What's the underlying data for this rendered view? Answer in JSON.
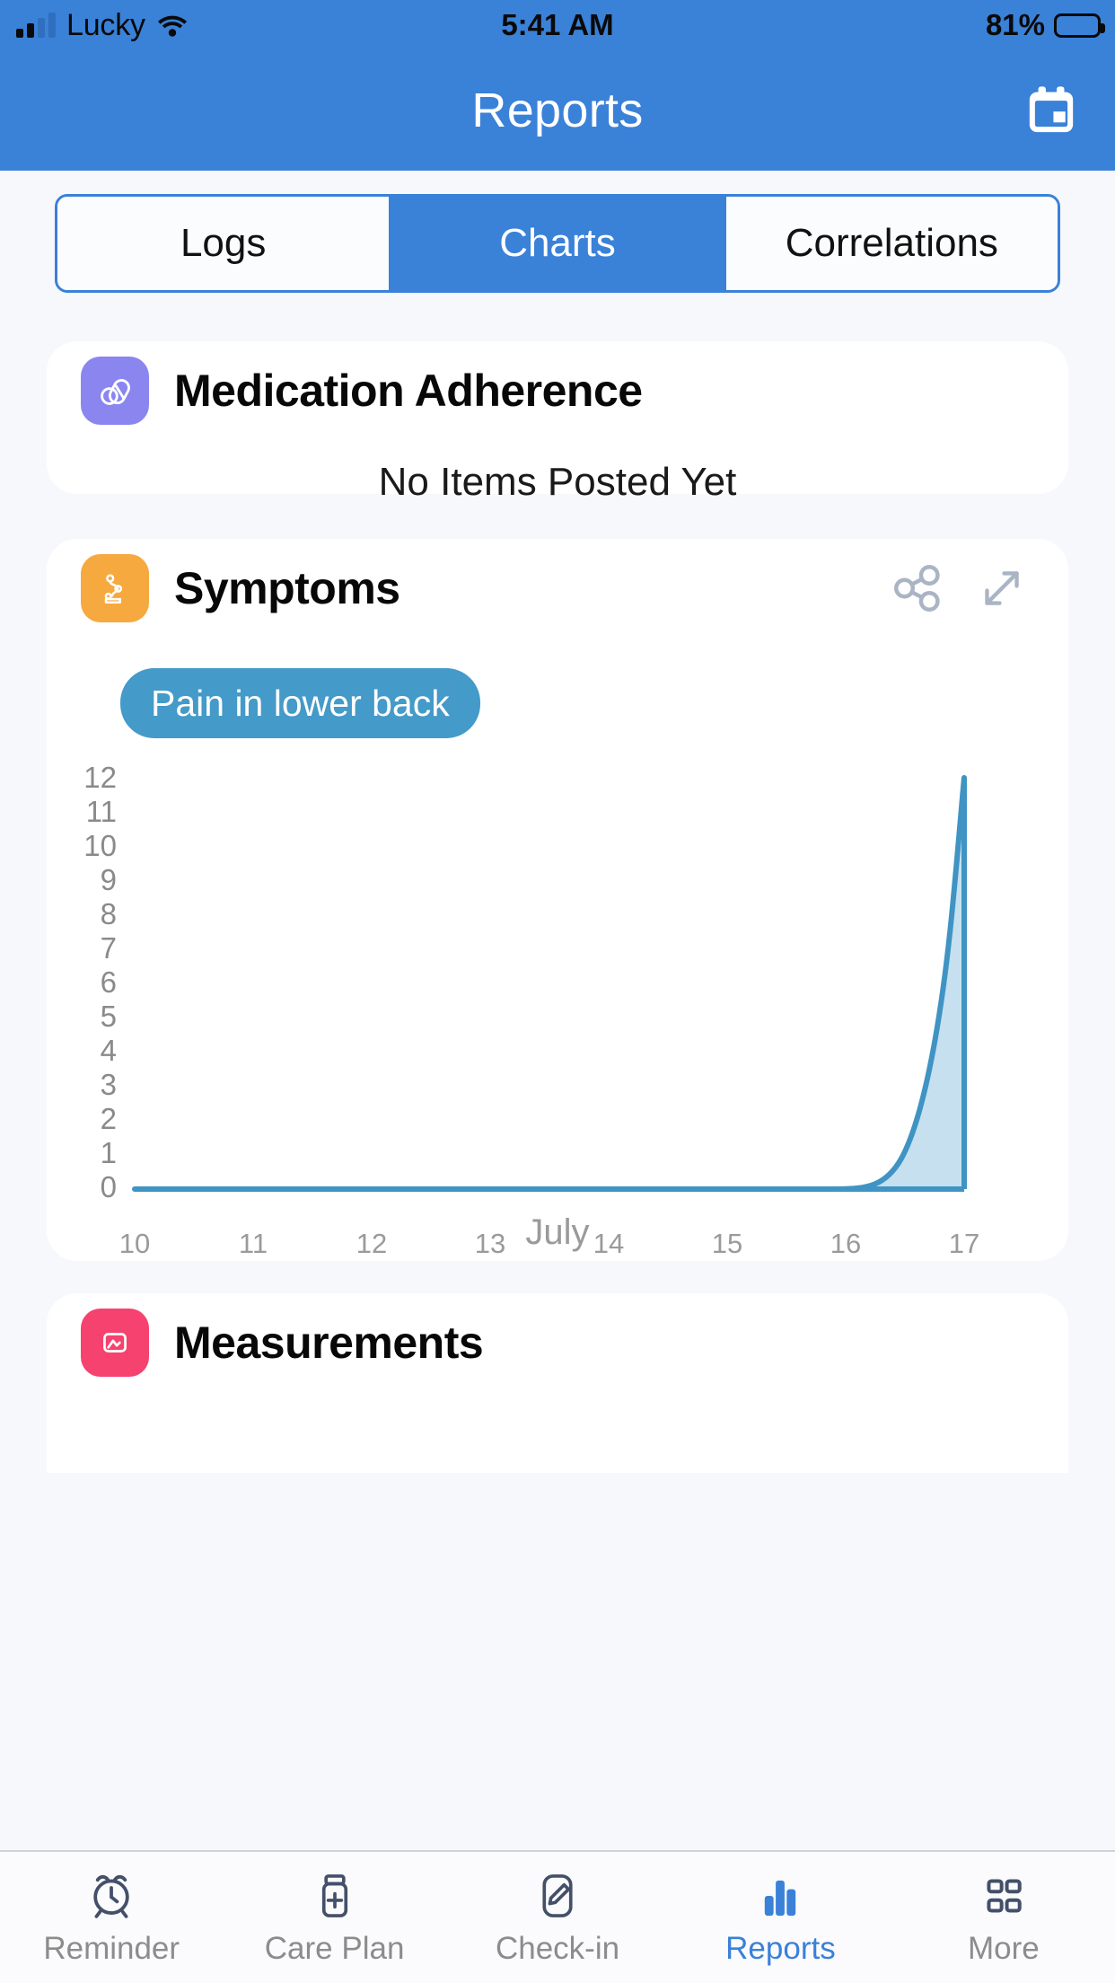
{
  "status_bar": {
    "carrier": "Lucky",
    "time": "5:41 AM",
    "battery_percent": "81%",
    "signal_icon": "cellular-signal-icon",
    "wifi_icon": "wifi-icon",
    "battery_icon": "battery-icon"
  },
  "nav": {
    "title": "Reports",
    "action_icon": "calendar-icon"
  },
  "segmented": {
    "options": [
      {
        "label": "Logs",
        "selected": false
      },
      {
        "label": "Charts",
        "selected": true
      },
      {
        "label": "Correlations",
        "selected": false
      }
    ]
  },
  "cards": {
    "medication": {
      "title": "Medication Adherence",
      "icon": "pill-icon",
      "icon_color": "#8b85f0",
      "empty_message": "No Items Posted Yet"
    },
    "symptoms": {
      "title": "Symptoms",
      "icon": "symptom-body-icon",
      "icon_color": "#f6a93f",
      "share_icon": "share-nodes-icon",
      "expand_icon": "expand-arrows-icon",
      "chip": "Pain in lower back"
    },
    "measurements": {
      "title": "Measurements",
      "icon": "measurements-icon",
      "icon_color": "#f6426f"
    }
  },
  "chart_data": {
    "type": "area",
    "title": "Pain in lower back",
    "xlabel": "July",
    "ylabel": "",
    "x": [
      10,
      11,
      12,
      13,
      14,
      15,
      16,
      17
    ],
    "values": [
      0,
      0,
      0,
      0,
      0,
      0,
      0,
      12
    ],
    "x_tick_labels": [
      "10",
      "11",
      "12",
      "13",
      "14",
      "15",
      "16",
      "17"
    ],
    "y_tick_labels": [
      "12",
      "11",
      "10",
      "9",
      "8",
      "7",
      "6",
      "5",
      "4",
      "3",
      "2",
      "1",
      "0"
    ],
    "ylim": [
      0,
      12
    ],
    "xlim": [
      10,
      17
    ],
    "grid": false,
    "legend": "none",
    "line_color": "#3f94c4",
    "fill_color": "#c6e0ef"
  },
  "tabs": [
    {
      "label": "Reminder",
      "icon": "alarm-clock-icon",
      "active": false
    },
    {
      "label": "Care Plan",
      "icon": "pill-bottle-icon",
      "active": false
    },
    {
      "label": "Check-in",
      "icon": "pencil-square-icon",
      "active": false
    },
    {
      "label": "Reports",
      "icon": "bar-chart-icon",
      "active": true
    },
    {
      "label": "More",
      "icon": "grid-squares-icon",
      "active": false
    }
  ],
  "colors": {
    "brand_blue": "#3a81d8",
    "page_bg": "#f7f8fc",
    "chip_blue": "#449ac8"
  }
}
